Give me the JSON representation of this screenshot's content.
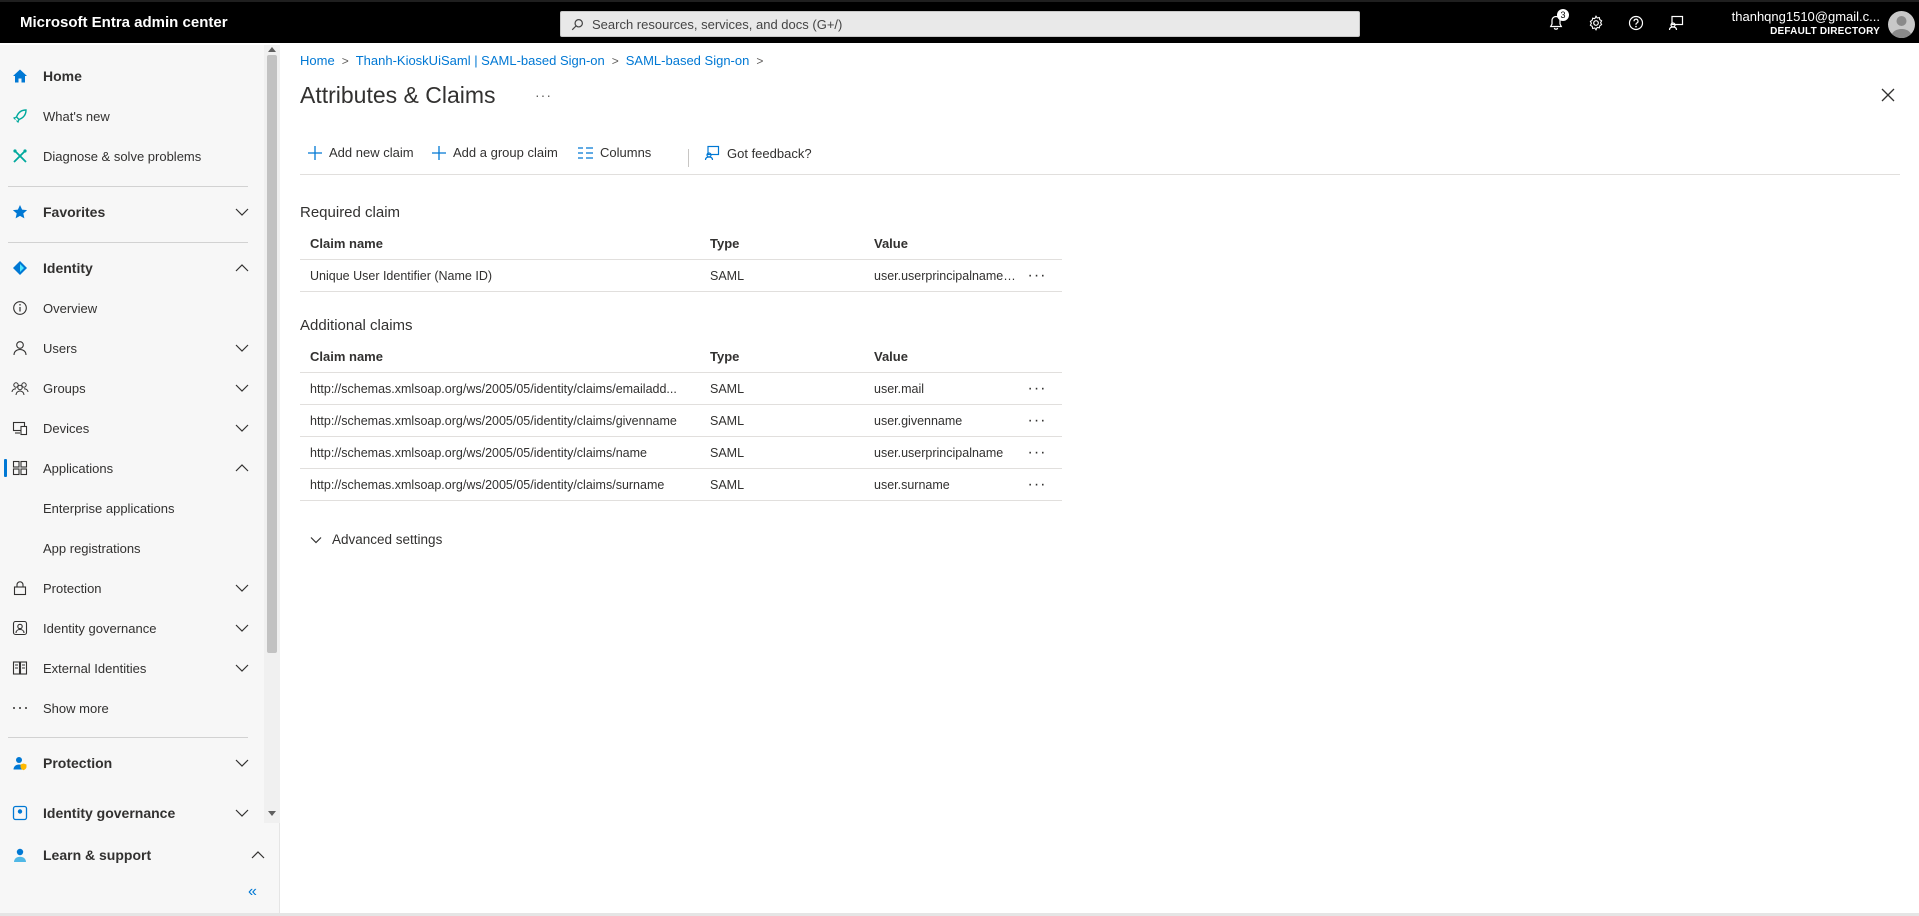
{
  "app": {
    "title": "Microsoft Entra admin center",
    "search_placeholder": "Search resources, services, and docs (G+/)",
    "notifications_count": "3",
    "account_email": "thanhqng1510@gmail.c...",
    "account_directory": "DEFAULT DIRECTORY"
  },
  "sidebar": {
    "home": "Home",
    "whats_new": "What's new",
    "diagnose": "Diagnose & solve problems",
    "favorites": "Favorites",
    "identity": "Identity",
    "overview": "Overview",
    "users": "Users",
    "groups": "Groups",
    "devices": "Devices",
    "applications": "Applications",
    "enterprise_apps": "Enterprise applications",
    "app_registrations": "App registrations",
    "protection_sub": "Protection",
    "identity_governance_sub": "Identity governance",
    "external_identities": "External Identities",
    "show_more": "Show more",
    "protection": "Protection",
    "identity_governance": "Identity governance",
    "learn_support": "Learn & support",
    "collapse": "«"
  },
  "breadcrumb": {
    "home": "Home",
    "app": "Thanh-KioskUiSaml | SAML-based Sign-on",
    "saml": "SAML-based Sign-on"
  },
  "page": {
    "title": "Attributes & Claims",
    "more": "···"
  },
  "toolbar": {
    "add_claim": "Add new claim",
    "add_group_claim": "Add a group claim",
    "columns": "Columns",
    "feedback": "Got feedback?"
  },
  "required": {
    "title": "Required claim",
    "headers": {
      "name": "Claim name",
      "type": "Type",
      "value": "Value"
    },
    "rows": [
      {
        "name": "Unique User Identifier (Name ID)",
        "type": "SAML",
        "value": "user.userprincipalname [..."
      }
    ]
  },
  "additional": {
    "title": "Additional claims",
    "headers": {
      "name": "Claim name",
      "type": "Type",
      "value": "Value"
    },
    "rows": [
      {
        "name": "http://schemas.xmlsoap.org/ws/2005/05/identity/claims/emailadd...",
        "type": "SAML",
        "value": "user.mail"
      },
      {
        "name": "http://schemas.xmlsoap.org/ws/2005/05/identity/claims/givenname",
        "type": "SAML",
        "value": "user.givenname"
      },
      {
        "name": "http://schemas.xmlsoap.org/ws/2005/05/identity/claims/name",
        "type": "SAML",
        "value": "user.userprincipalname"
      },
      {
        "name": "http://schemas.xmlsoap.org/ws/2005/05/identity/claims/surname",
        "type": "SAML",
        "value": "user.surname"
      }
    ]
  },
  "row_menu": "···",
  "advanced": {
    "label": "Advanced settings"
  },
  "colors": {
    "accent": "#0078d4",
    "topbar": "#000000",
    "sidebar_bg": "#f7f7f7"
  }
}
